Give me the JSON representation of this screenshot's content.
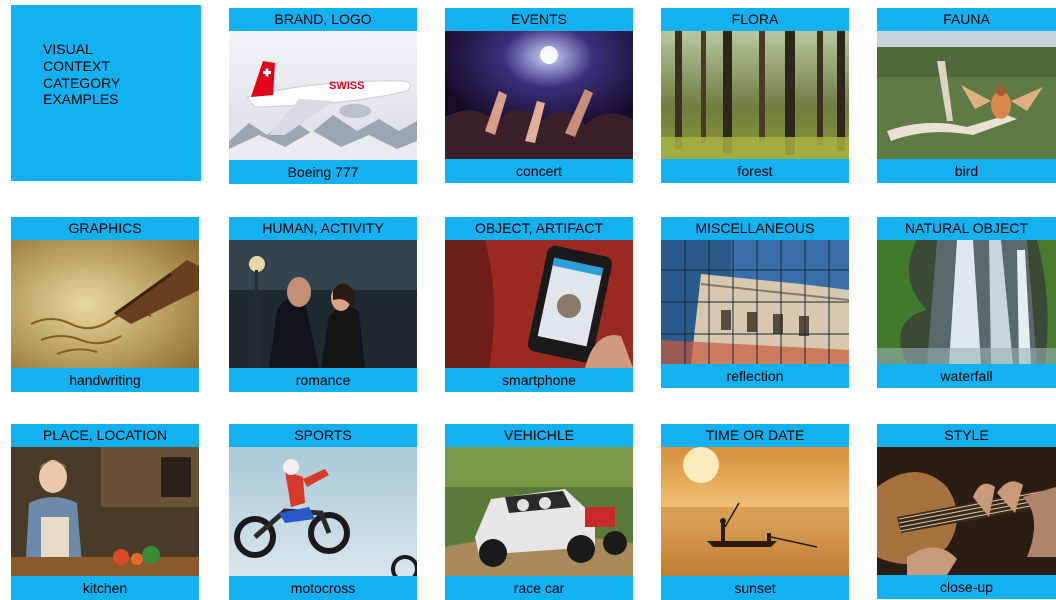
{
  "intro": {
    "lines": [
      "VISUAL",
      "CONTEXT",
      "CATEGORY",
      "EXAMPLES"
    ]
  },
  "cards": [
    {
      "category": "BRAND, LOGO",
      "example": "Boeing 777",
      "image": "airplane-photo"
    },
    {
      "category": "EVENTS",
      "example": "concert",
      "image": "concert-photo"
    },
    {
      "category": "FLORA",
      "example": "forest",
      "image": "forest-photo"
    },
    {
      "category": "FAUNA",
      "example": "bird",
      "image": "bird-photo"
    },
    {
      "category": "GRAPHICS",
      "example": "handwriting",
      "image": "handwriting-photo"
    },
    {
      "category": "HUMAN, ACTIVITY",
      "example": "romance",
      "image": "romance-photo"
    },
    {
      "category": "OBJECT, ARTIFACT",
      "example": "smartphone",
      "image": "smartphone-photo"
    },
    {
      "category": "MISCELLANEOUS",
      "example": "reflection",
      "image": "reflection-photo"
    },
    {
      "category": "NATURAL OBJECT",
      "example": "waterfall",
      "image": "waterfall-photo"
    },
    {
      "category": "PLACE, LOCATION",
      "example": "kitchen",
      "image": "kitchen-photo"
    },
    {
      "category": "SPORTS",
      "example": "motocross",
      "image": "motocross-photo"
    },
    {
      "category": "VEHICHLE",
      "example": "race car",
      "image": "race-car-photo"
    },
    {
      "category": "TIME OR DATE",
      "example": "sunset",
      "image": "sunset-photo"
    },
    {
      "category": "STYLE",
      "example": "close-up",
      "image": "close-up-photo"
    }
  ],
  "airplane_livery": "SWISS",
  "colors": {
    "accent": "#13b1f0"
  }
}
